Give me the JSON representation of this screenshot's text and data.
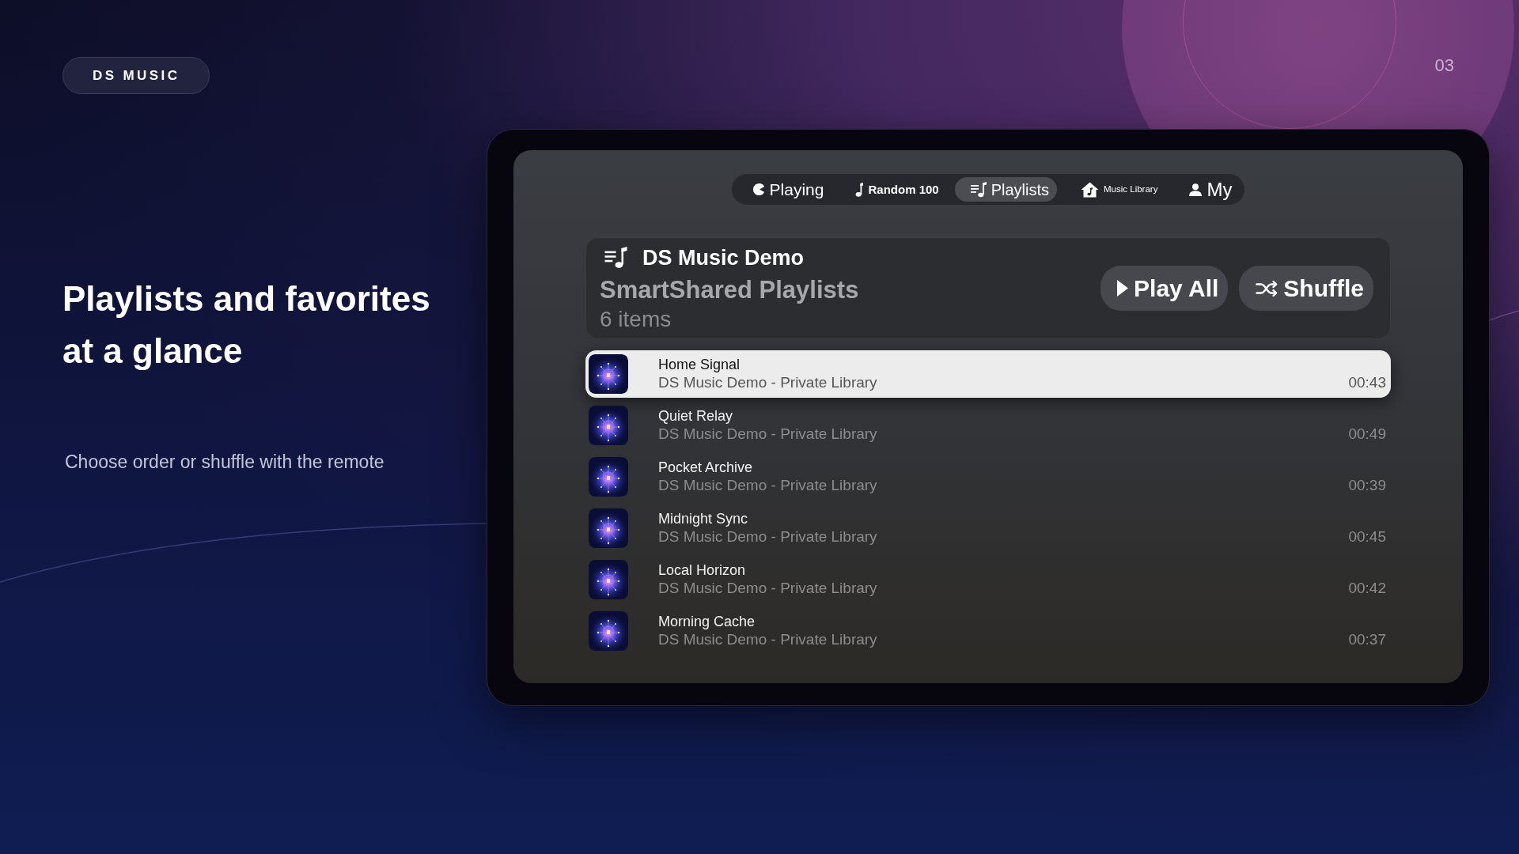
{
  "brand_badge": {
    "label": "DS MUSIC"
  },
  "page_number": "03",
  "headline": "Playlists and favorites at a glance",
  "subtitle": "Choose order or shuffle with the remote",
  "tabs": [
    {
      "label": "Playing",
      "selected": false
    },
    {
      "label": "Random 100",
      "selected": false
    },
    {
      "label": "Playlists",
      "selected": true
    },
    {
      "label": "Music Library",
      "selected": false
    },
    {
      "label": "My",
      "selected": false
    }
  ],
  "playlist": {
    "title": "DS Music Demo",
    "source": "SmartShared Playlists",
    "count": "6 items",
    "actions": [
      {
        "label": "Play All"
      },
      {
        "label": "Shuffle"
      }
    ]
  },
  "tracks": [
    {
      "title": "Home Signal",
      "detail": "DS Music Demo - Private Library",
      "duration": "00:43",
      "selected": true
    },
    {
      "title": "Quiet Relay",
      "detail": "DS Music Demo - Private Library",
      "duration": "00:49",
      "selected": false
    },
    {
      "title": "Pocket Archive",
      "detail": "DS Music Demo - Private Library",
      "duration": "00:39",
      "selected": false
    },
    {
      "title": "Midnight Sync",
      "detail": "DS Music Demo - Private Library",
      "duration": "00:45",
      "selected": false
    },
    {
      "title": "Local Horizon",
      "detail": "DS Music Demo - Private Library",
      "duration": "00:42",
      "selected": false
    },
    {
      "title": "Morning Cache",
      "detail": "DS Music Demo - Private Library",
      "duration": "00:37",
      "selected": false
    }
  ]
}
